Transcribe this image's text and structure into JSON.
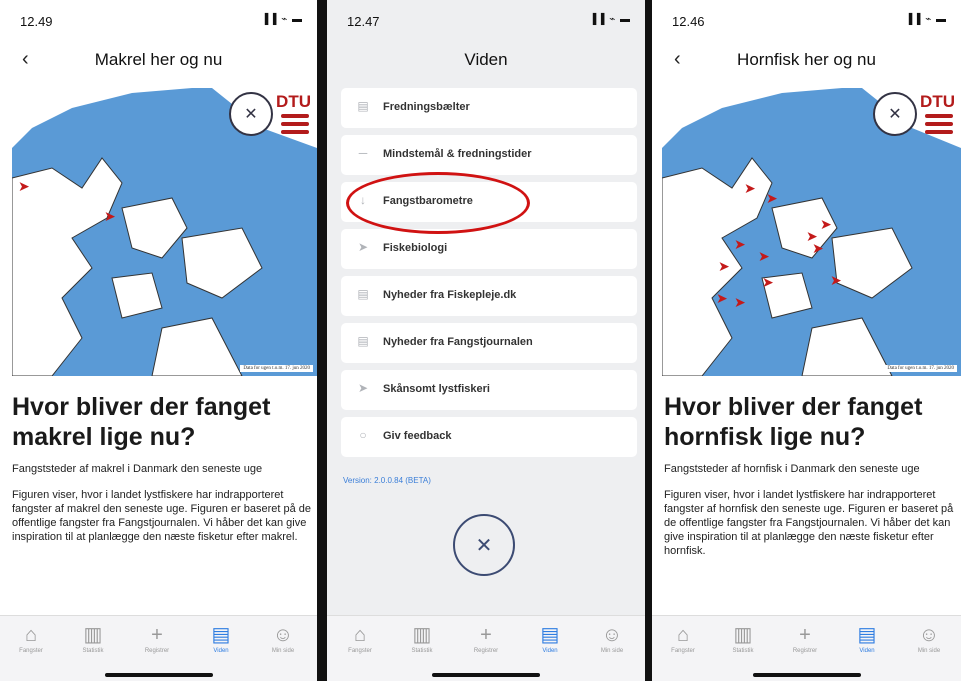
{
  "screens": [
    {
      "time": "12.49",
      "signal": "▐▐ ⌁ ▬",
      "title": "Makrel her og nu",
      "map_logo": "DTU",
      "map_caption": "Data for ugen t.o.m. 17. jun 2020",
      "headline": "Hvor bliver der fanget makrel lige nu?",
      "subtitle": "Fangststeder af makrel i Danmark den seneste uge",
      "body": "Figuren viser, hvor i landet lystfiskere har indrapporteret fangster af makrel den seneste uge. Figuren er baseret på de offentlige fangster fra Fangstjournalen. Vi håber det kan give inspiration til at planlægge den næste fisketur efter makrel."
    },
    {
      "time": "12.47",
      "signal": "▐▐ ⌁ ▬",
      "title": "Viden",
      "menu": [
        {
          "label": "Fredningsbælter",
          "icon": "book-icon"
        },
        {
          "label": "Mindstemål & fredningstider",
          "icon": "ruler-icon"
        },
        {
          "label": "Fangstbarometre",
          "icon": "thermometer-icon"
        },
        {
          "label": "Fiskebiologi",
          "icon": "fish-icon"
        },
        {
          "label": "Nyheder fra Fiskepleje.dk",
          "icon": "book-icon"
        },
        {
          "label": "Nyheder fra Fangstjournalen",
          "icon": "book-icon"
        },
        {
          "label": "Skånsomt lystfiskeri",
          "icon": "fish-icon"
        },
        {
          "label": "Giv feedback",
          "icon": "chat-icon"
        }
      ],
      "version": "Version: 2.0.0.84 (BETA)"
    },
    {
      "time": "12.46",
      "signal": "▐▐ ⌁ ▬",
      "title": "Hornfisk her og nu",
      "map_logo": "DTU",
      "map_caption": "Data for ugen t.o.m. 17. jun 2020",
      "headline": "Hvor bliver der fanget hornfisk lige nu?",
      "subtitle": "Fangststeder af hornfisk i Danmark den seneste uge",
      "body": "Figuren viser, hvor i landet lystfiskere har indrapporteret fangster af hornfisk den seneste uge. Figuren er baseret på de offentlige fangster fra Fangstjournalen. Vi håber det kan give inspiration til at planlægge den næste fisketur efter hornfisk."
    }
  ],
  "tabs": [
    {
      "label": "Fangster",
      "icon": "home-icon"
    },
    {
      "label": "Statistik",
      "icon": "bar-chart-icon"
    },
    {
      "label": "Registrer",
      "icon": "plus-icon"
    },
    {
      "label": "Viden",
      "icon": "book-icon"
    },
    {
      "label": "Min side",
      "icon": "person-icon"
    }
  ],
  "active_tab": "Viden",
  "colors": {
    "accent": "#2f7de1",
    "annotation": "#d01212",
    "sea": "#4a8fcf",
    "land": "#ffffff",
    "dtu_red": "#b31b1b"
  }
}
